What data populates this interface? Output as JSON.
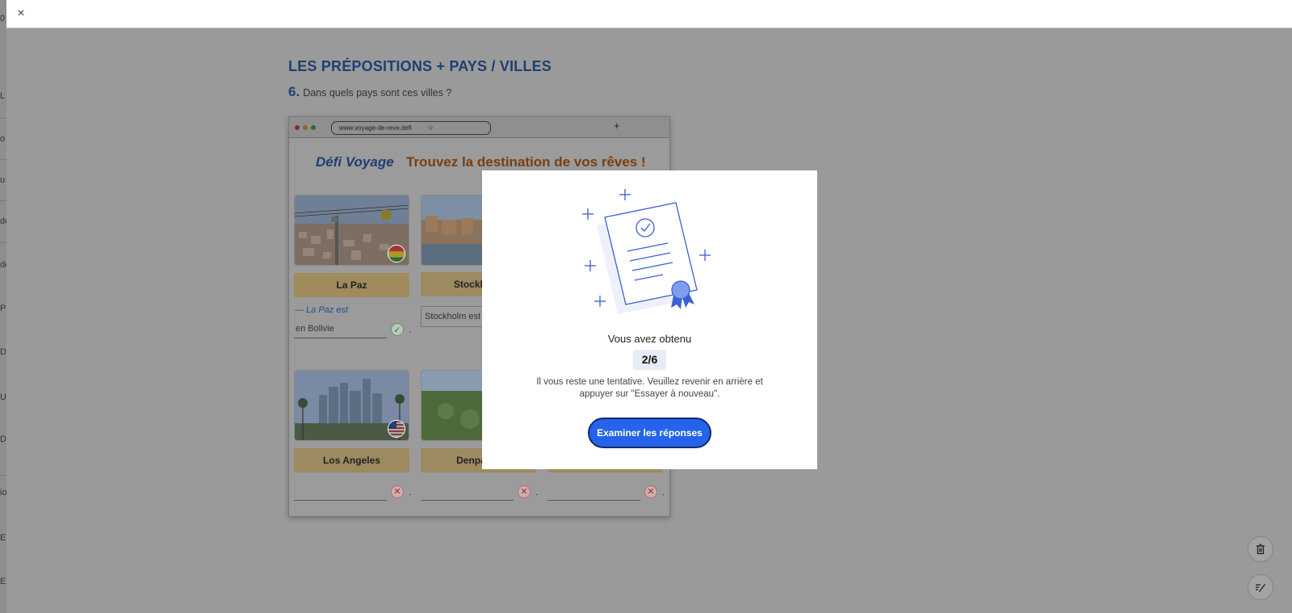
{
  "sidebar_fragments": [
    "0",
    "L",
    "o",
    "u",
    "de",
    "de",
    "Po",
    "D'",
    "Un",
    "D",
    "io",
    "En",
    "En"
  ],
  "topbar": {
    "close_icon": "×"
  },
  "lesson": {
    "title": "LES PRÉPOSITIONS + PAYS / VILLES",
    "question_number": "6.",
    "question_text": "Dans quels pays sont ces villes ?"
  },
  "browser": {
    "url": "www.voyage-de-reve.defi",
    "star_icon": "☆",
    "new_tab_icon": "+",
    "brand": "Défi Voyage",
    "headline": "Trouvez la destination de vos rêves !",
    "cards": [
      {
        "city": "La Paz",
        "hint": "— La Paz est",
        "answer": "en Bolivie",
        "status": "correct"
      },
      {
        "city": "Stockholm",
        "hint": "",
        "answer": "Stockholm est",
        "status": ""
      },
      {
        "city": "Los Angeles",
        "hint": "",
        "answer": "",
        "status": "wrong"
      },
      {
        "city": "Denpasar",
        "hint": "",
        "answer": "",
        "status": "wrong"
      },
      {
        "city": "",
        "hint": "",
        "answer": "",
        "status": "wrong"
      }
    ],
    "period": "."
  },
  "modal": {
    "label": "Vous avez obtenu",
    "score": "2/6",
    "message": "Il vous reste une tentative. Veuillez revenir en arrière et appuyer sur \"Essayer à nouveau\".",
    "button": "Examiner les réponses"
  },
  "colors": {
    "accent": "#2563eb",
    "title_blue": "#1e3f73",
    "headline_brown": "#7a3f0e",
    "label_gold": "#e3c07d"
  },
  "icons": {
    "trash": "trash-icon",
    "edit": "edit-icon"
  }
}
